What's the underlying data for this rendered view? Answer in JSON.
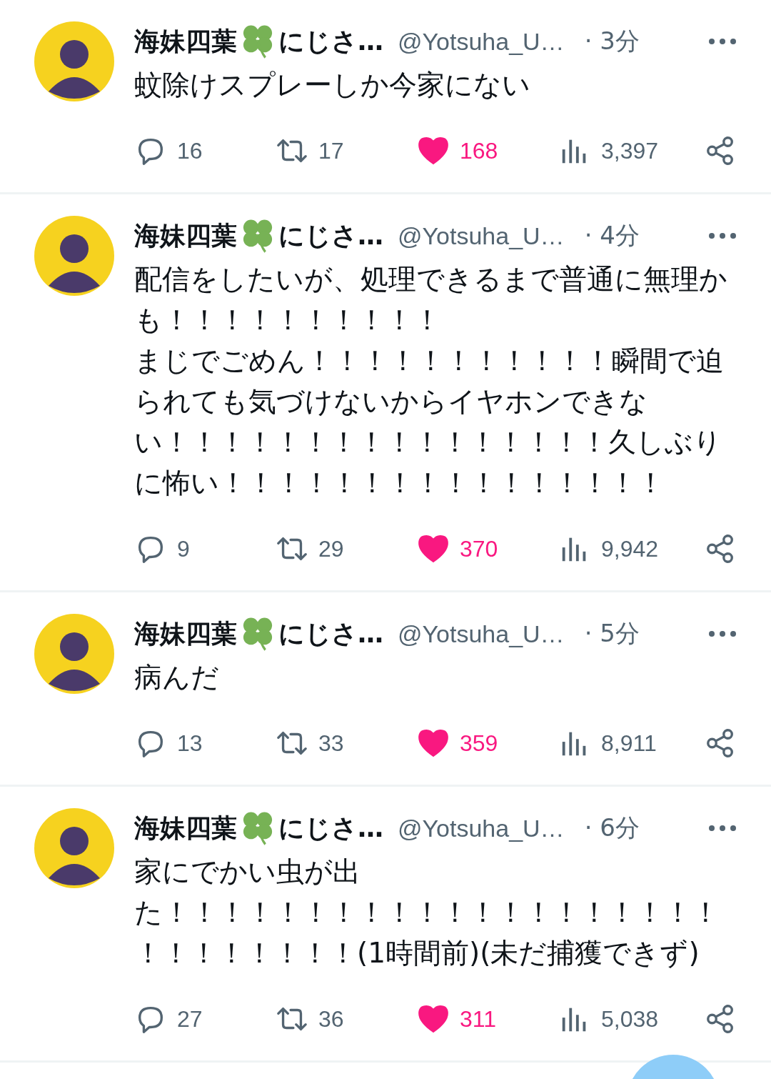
{
  "tweets": [
    {
      "name": "海妹四葉",
      "name_suffix": "にじさ…",
      "handle": "@Yotsuha_U…",
      "time": "· 3分",
      "text": [
        "蚊除けスプレーしか今家にない"
      ],
      "replies": "16",
      "retweets": "17",
      "likes": "168",
      "liked": true,
      "views": "3,397"
    },
    {
      "name": "海妹四葉",
      "name_suffix": "にじさ…",
      "handle": "@Yotsuha_U…",
      "time": "· 4分",
      "text": [
        "配信をしたいが、処理できるまで普通に無理かも！！！！！！！！！！",
        "まじでごめん！！！！！！！！！！！瞬間で迫られても気づけないからイヤホンできない！！！！！！！！！！！！！！！！久しぶりに怖い！！！！！！！！！！！！！！！！"
      ],
      "replies": "9",
      "retweets": "29",
      "likes": "370",
      "liked": true,
      "views": "9,942"
    },
    {
      "name": "海妹四葉",
      "name_suffix": "にじさ…",
      "handle": "@Yotsuha_U…",
      "time": "· 5分",
      "text": [
        "病んだ"
      ],
      "replies": "13",
      "retweets": "33",
      "likes": "359",
      "liked": true,
      "views": "8,911"
    },
    {
      "name": "海妹四葉",
      "name_suffix": "にじさ…",
      "handle": "@Yotsuha_U…",
      "time": "· 6分",
      "text": [
        "家にでかい虫が出た！！！！！！！！！！！！！！！！！！！！！！！！！！！！(1時間前)(未だ捕獲できず)"
      ],
      "replies": "27",
      "retweets": "36",
      "likes": "311",
      "liked": true,
      "views": "5,038"
    }
  ]
}
